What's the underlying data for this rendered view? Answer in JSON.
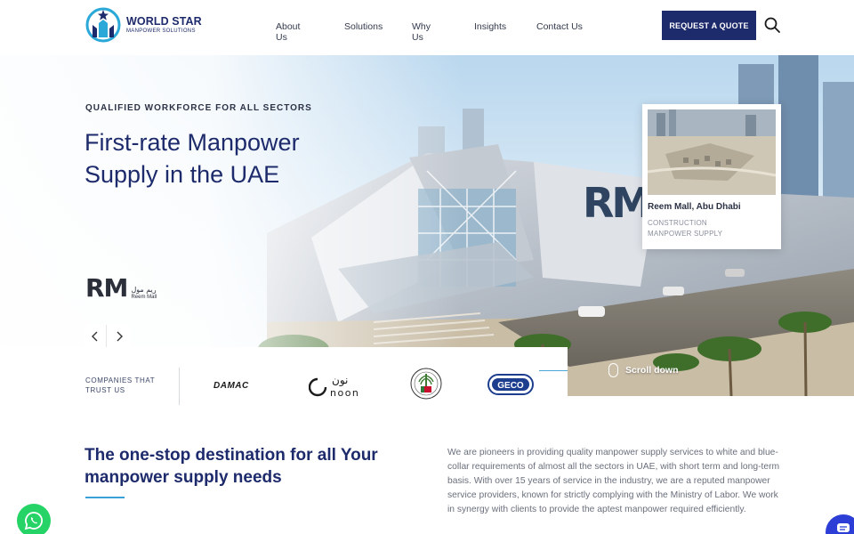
{
  "header": {
    "brand_name": "WORLD STAR",
    "brand_sub": "MANPOWER SOLUTIONS",
    "logo_icon": "star-tower-logo-icon",
    "nav": [
      "About Us",
      "Solutions",
      "Why Us",
      "Insights",
      "Contact Us"
    ],
    "cta_label": "REQUEST A QUOTE",
    "search_icon": "search-icon"
  },
  "hero": {
    "eyebrow": "QUALIFIED WORKFORCE FOR ALL SECTORS",
    "title": "First-rate Manpower Supply in the UAE",
    "slide_logo": {
      "mark": "RM",
      "arabic": "ريم مول",
      "label": "Reem Mall"
    },
    "prev_icon": "chevron-left-icon",
    "next_icon": "chevron-right-icon",
    "project": {
      "name": "Reem Mall, Abu Dhabi",
      "tag_line1": "CONSTRUCTION",
      "tag_line2": "MANPOWER SUPPLY"
    }
  },
  "clients": {
    "label": "COMPANIES THAT TRUST US",
    "brands": {
      "damac": "DAMAC",
      "noon_arabic": "نون",
      "noon": "noon",
      "geco": "GECO"
    },
    "scroll_label": "Scroll down"
  },
  "intro": {
    "title": "The one-stop destination for all Your manpower supply needs",
    "text": "We are pioneers in providing quality manpower supply services to white and blue-collar requirements of almost all the sectors in UAE, with short term and long-term basis. With over 15 years of service in the industry, we are a reputed manpower service providers, known for strictly complying with the Ministry of Labor. We work in synergy with clients to provide the aptest manpower required efficiently."
  },
  "colors": {
    "brand_navy": "#1d2a6b",
    "accent_blue": "#3aa0d8",
    "whatsapp_green": "#25d366",
    "chat_blue": "#2c3ed6"
  }
}
